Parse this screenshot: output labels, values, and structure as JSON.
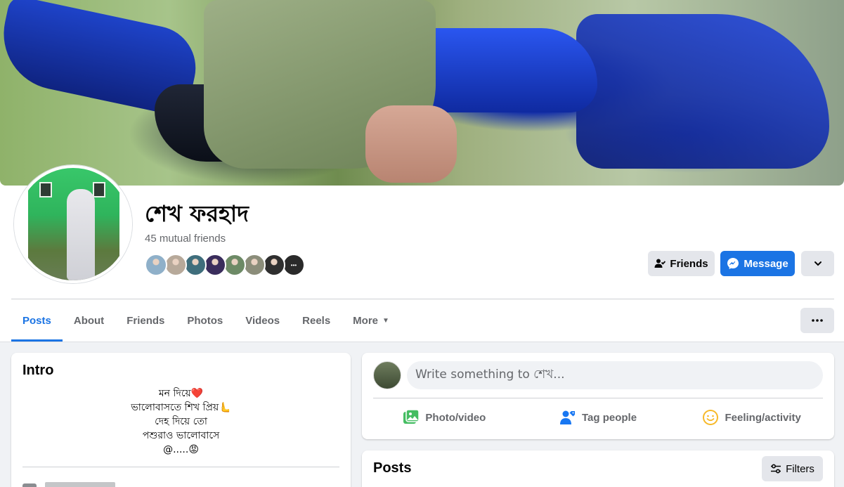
{
  "profile": {
    "name": "শেখ ফরহাদ",
    "mutual_friends": "45 mutual friends",
    "friend_faces": [
      {
        "color": "#8fb0c9"
      },
      {
        "color": "#b7a99a"
      },
      {
        "color": "#3f6e7c"
      },
      {
        "color": "#3a2d5c"
      },
      {
        "color": "#6d8a66"
      },
      {
        "color": "#8b8d7a"
      },
      {
        "color": "#2f2f2f"
      },
      {
        "color": "#2a2a2a"
      }
    ]
  },
  "actions": {
    "friends_label": "Friends",
    "message_label": "Message"
  },
  "tabs": [
    {
      "label": "Posts"
    },
    {
      "label": "About"
    },
    {
      "label": "Friends"
    },
    {
      "label": "Photos"
    },
    {
      "label": "Videos"
    },
    {
      "label": "Reels"
    },
    {
      "label": "More"
    }
  ],
  "intro": {
    "title": "Intro",
    "bio_lines": [
      "মন দিয়ে❤️",
      "ভালোবাসতে শিখ প্রিয়🫷",
      "দেহ দিয়ে তো",
      "পশুরাও ভালোবাসে",
      "@.....😡"
    ]
  },
  "composer": {
    "placeholder": "Write something to শেখ...",
    "photo_video": "Photo/video",
    "tag_people": "Tag people",
    "feeling_activity": "Feeling/activity"
  },
  "posts": {
    "title": "Posts",
    "filters_label": "Filters"
  },
  "colors": {
    "accent": "#1b74e4",
    "photo_green": "#45bd62",
    "tag_blue": "#1877f2",
    "feeling_yellow": "#f7b928"
  }
}
